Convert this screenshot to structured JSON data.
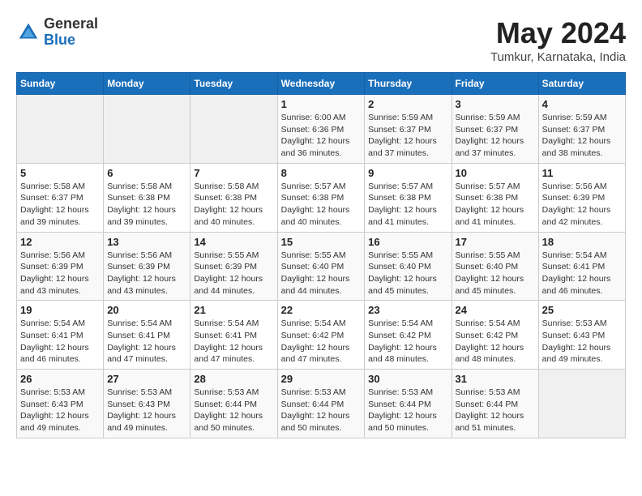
{
  "header": {
    "logo": {
      "general": "General",
      "blue": "Blue"
    },
    "title": "May 2024",
    "location": "Tumkur, Karnataka, India"
  },
  "weekdays": [
    "Sunday",
    "Monday",
    "Tuesday",
    "Wednesday",
    "Thursday",
    "Friday",
    "Saturday"
  ],
  "weeks": [
    [
      {
        "day": "",
        "info": ""
      },
      {
        "day": "",
        "info": ""
      },
      {
        "day": "",
        "info": ""
      },
      {
        "day": "1",
        "info": "Sunrise: 6:00 AM\nSunset: 6:36 PM\nDaylight: 12 hours\nand 36 minutes."
      },
      {
        "day": "2",
        "info": "Sunrise: 5:59 AM\nSunset: 6:37 PM\nDaylight: 12 hours\nand 37 minutes."
      },
      {
        "day": "3",
        "info": "Sunrise: 5:59 AM\nSunset: 6:37 PM\nDaylight: 12 hours\nand 37 minutes."
      },
      {
        "day": "4",
        "info": "Sunrise: 5:59 AM\nSunset: 6:37 PM\nDaylight: 12 hours\nand 38 minutes."
      }
    ],
    [
      {
        "day": "5",
        "info": "Sunrise: 5:58 AM\nSunset: 6:37 PM\nDaylight: 12 hours\nand 39 minutes."
      },
      {
        "day": "6",
        "info": "Sunrise: 5:58 AM\nSunset: 6:38 PM\nDaylight: 12 hours\nand 39 minutes."
      },
      {
        "day": "7",
        "info": "Sunrise: 5:58 AM\nSunset: 6:38 PM\nDaylight: 12 hours\nand 40 minutes."
      },
      {
        "day": "8",
        "info": "Sunrise: 5:57 AM\nSunset: 6:38 PM\nDaylight: 12 hours\nand 40 minutes."
      },
      {
        "day": "9",
        "info": "Sunrise: 5:57 AM\nSunset: 6:38 PM\nDaylight: 12 hours\nand 41 minutes."
      },
      {
        "day": "10",
        "info": "Sunrise: 5:57 AM\nSunset: 6:38 PM\nDaylight: 12 hours\nand 41 minutes."
      },
      {
        "day": "11",
        "info": "Sunrise: 5:56 AM\nSunset: 6:39 PM\nDaylight: 12 hours\nand 42 minutes."
      }
    ],
    [
      {
        "day": "12",
        "info": "Sunrise: 5:56 AM\nSunset: 6:39 PM\nDaylight: 12 hours\nand 43 minutes."
      },
      {
        "day": "13",
        "info": "Sunrise: 5:56 AM\nSunset: 6:39 PM\nDaylight: 12 hours\nand 43 minutes."
      },
      {
        "day": "14",
        "info": "Sunrise: 5:55 AM\nSunset: 6:39 PM\nDaylight: 12 hours\nand 44 minutes."
      },
      {
        "day": "15",
        "info": "Sunrise: 5:55 AM\nSunset: 6:40 PM\nDaylight: 12 hours\nand 44 minutes."
      },
      {
        "day": "16",
        "info": "Sunrise: 5:55 AM\nSunset: 6:40 PM\nDaylight: 12 hours\nand 45 minutes."
      },
      {
        "day": "17",
        "info": "Sunrise: 5:55 AM\nSunset: 6:40 PM\nDaylight: 12 hours\nand 45 minutes."
      },
      {
        "day": "18",
        "info": "Sunrise: 5:54 AM\nSunset: 6:41 PM\nDaylight: 12 hours\nand 46 minutes."
      }
    ],
    [
      {
        "day": "19",
        "info": "Sunrise: 5:54 AM\nSunset: 6:41 PM\nDaylight: 12 hours\nand 46 minutes."
      },
      {
        "day": "20",
        "info": "Sunrise: 5:54 AM\nSunset: 6:41 PM\nDaylight: 12 hours\nand 47 minutes."
      },
      {
        "day": "21",
        "info": "Sunrise: 5:54 AM\nSunset: 6:41 PM\nDaylight: 12 hours\nand 47 minutes."
      },
      {
        "day": "22",
        "info": "Sunrise: 5:54 AM\nSunset: 6:42 PM\nDaylight: 12 hours\nand 47 minutes."
      },
      {
        "day": "23",
        "info": "Sunrise: 5:54 AM\nSunset: 6:42 PM\nDaylight: 12 hours\nand 48 minutes."
      },
      {
        "day": "24",
        "info": "Sunrise: 5:54 AM\nSunset: 6:42 PM\nDaylight: 12 hours\nand 48 minutes."
      },
      {
        "day": "25",
        "info": "Sunrise: 5:53 AM\nSunset: 6:43 PM\nDaylight: 12 hours\nand 49 minutes."
      }
    ],
    [
      {
        "day": "26",
        "info": "Sunrise: 5:53 AM\nSunset: 6:43 PM\nDaylight: 12 hours\nand 49 minutes."
      },
      {
        "day": "27",
        "info": "Sunrise: 5:53 AM\nSunset: 6:43 PM\nDaylight: 12 hours\nand 49 minutes."
      },
      {
        "day": "28",
        "info": "Sunrise: 5:53 AM\nSunset: 6:44 PM\nDaylight: 12 hours\nand 50 minutes."
      },
      {
        "day": "29",
        "info": "Sunrise: 5:53 AM\nSunset: 6:44 PM\nDaylight: 12 hours\nand 50 minutes."
      },
      {
        "day": "30",
        "info": "Sunrise: 5:53 AM\nSunset: 6:44 PM\nDaylight: 12 hours\nand 50 minutes."
      },
      {
        "day": "31",
        "info": "Sunrise: 5:53 AM\nSunset: 6:44 PM\nDaylight: 12 hours\nand 51 minutes."
      },
      {
        "day": "",
        "info": ""
      }
    ]
  ]
}
